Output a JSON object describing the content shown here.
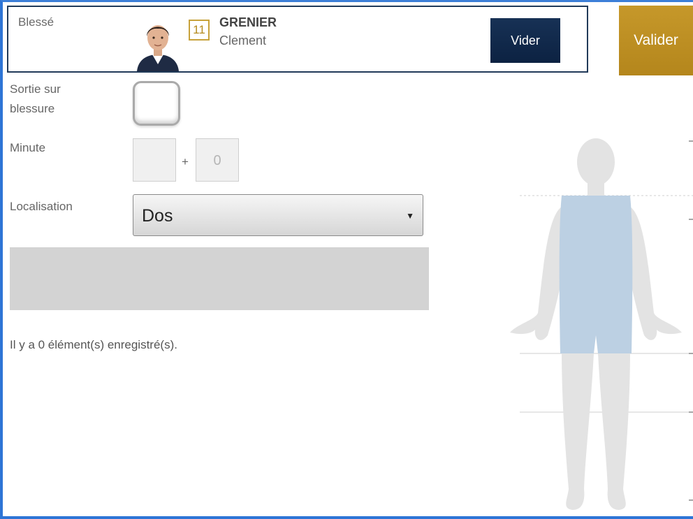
{
  "player": {
    "label": "Blessé",
    "number": "11",
    "last_name": "GRENIER",
    "first_name": "Clement"
  },
  "buttons": {
    "clear_label": "Vider",
    "validate_label": "Valider"
  },
  "form": {
    "injury_exit_label": "Sortie sur blessure",
    "injury_exit_checked": false,
    "minute_label": "Minute",
    "minute_value": "",
    "plus_sign": "+",
    "added_time_placeholder": "0",
    "location_label": "Localisation",
    "location_selected": "Dos"
  },
  "records": {
    "summary": "Il y a 0 élément(s) enregistré(s)."
  },
  "body_map": {
    "highlighted_zone": "Dos",
    "highlight_color": "#bcd0e3",
    "silhouette_color": "#e3e3e3"
  },
  "colors": {
    "frame": "#2e75d6",
    "clear_button": "#0f2648",
    "validate_button": "#bb8c20",
    "badge": "#c7a23b"
  }
}
